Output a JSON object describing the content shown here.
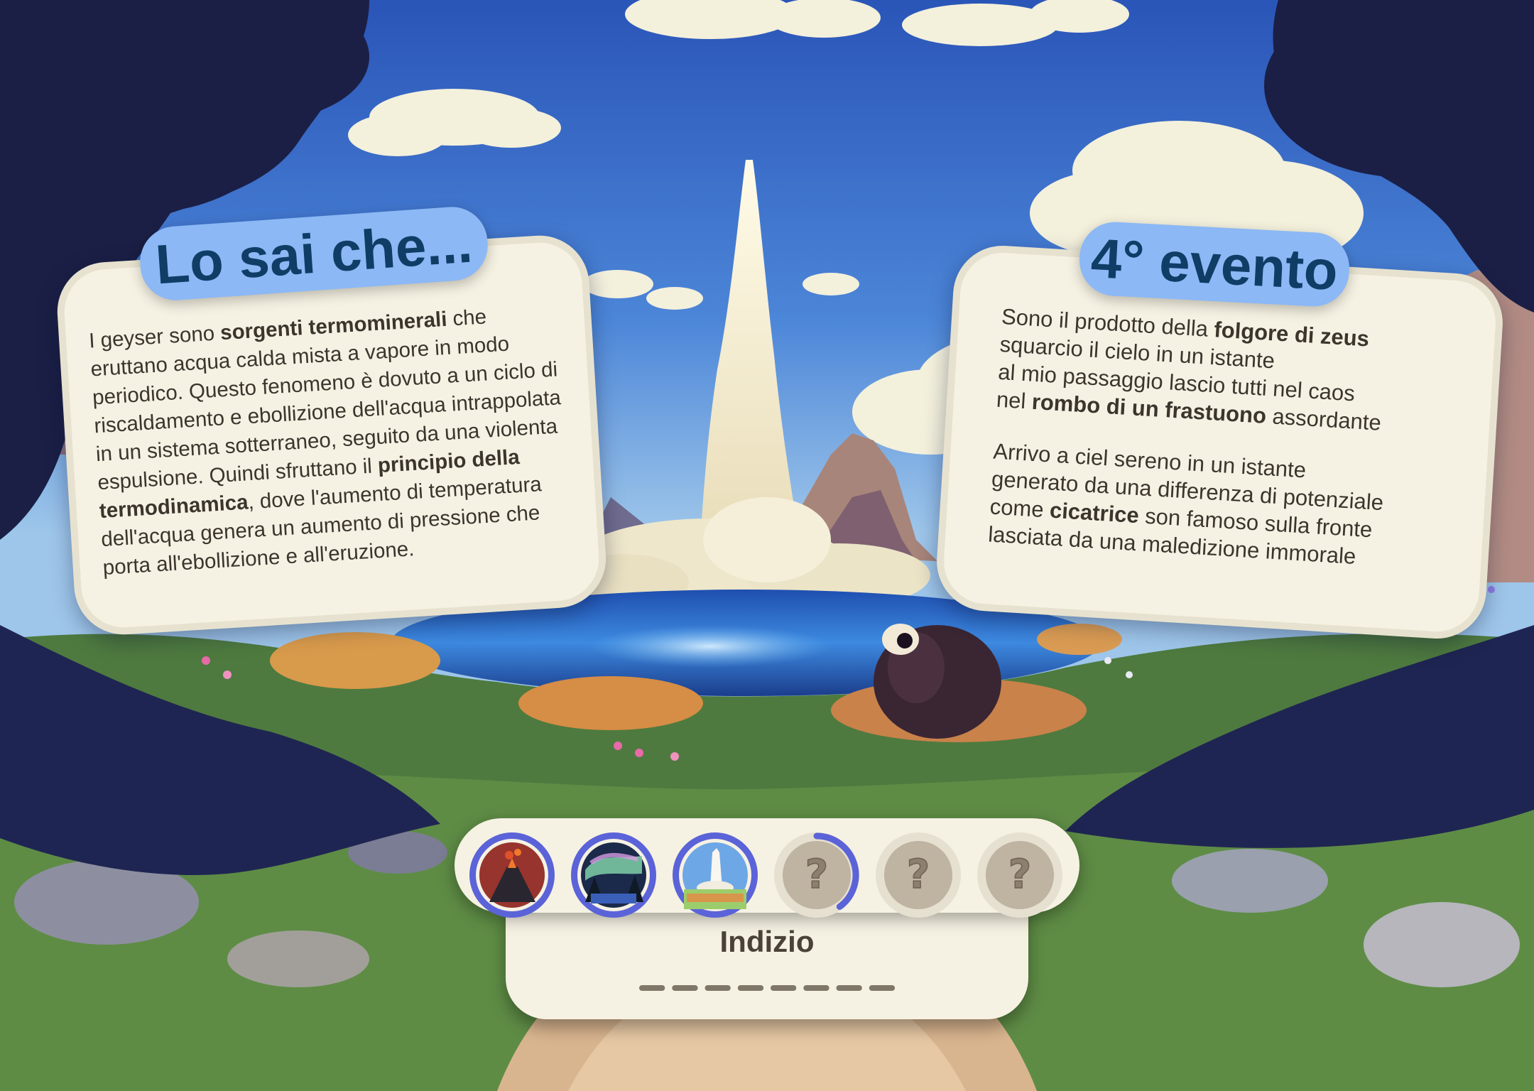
{
  "colors": {
    "card_bg": "#f6f2e3",
    "pill_bg": "#8cb8f5",
    "title_text": "#0f3d66",
    "progress_ring": "#5b63d8",
    "locked_slot": "#bfb3a2"
  },
  "fact_panel": {
    "title": "Lo sai che...",
    "segments": [
      {
        "text": "I geyser sono ",
        "bold": false
      },
      {
        "text": "sorgenti termominerali",
        "bold": true
      },
      {
        "text": " che eruttano acqua calda mista a vapore in modo periodico. Questo fenomeno è dovuto a un ciclo di riscaldamento e ebollizione dell'acqua intrappolata in un sistema sotterraneo, seguito da una violenta espulsione. Quindi sfruttano il ",
        "bold": false
      },
      {
        "text": "principio della termodinamica",
        "bold": true
      },
      {
        "text": ", dove l'aumento di temperatura dell'acqua genera un aumento di pressione che porta all'ebollizione e all'eruzione.",
        "bold": false
      }
    ]
  },
  "riddle_panel": {
    "title": "4° evento",
    "stanzas": [
      [
        [
          {
            "text": "Sono il prodotto della ",
            "bold": false
          },
          {
            "text": "folgore di zeus",
            "bold": true
          }
        ],
        [
          {
            "text": "squarcio il cielo in un istante",
            "bold": false
          }
        ],
        [
          {
            "text": "al mio passaggio lascio tutti nel caos",
            "bold": false
          }
        ],
        [
          {
            "text": "nel ",
            "bold": false
          },
          {
            "text": "rombo di un frastuono",
            "bold": true
          },
          {
            "text": " assordante",
            "bold": false
          }
        ]
      ],
      [
        [
          {
            "text": "Arrivo a ciel sereno in un istante",
            "bold": false
          }
        ],
        [
          {
            "text": "generato da una differenza di potenziale",
            "bold": false
          }
        ],
        [
          {
            "text": "come ",
            "bold": false
          },
          {
            "text": "cicatrice",
            "bold": true
          },
          {
            "text": " son famoso sulla fronte",
            "bold": false
          }
        ],
        [
          {
            "text": "lasciata da una maledizione immorale",
            "bold": false
          }
        ]
      ]
    ]
  },
  "progress": {
    "slots": [
      {
        "state": "completed",
        "icon": "volcano-icon"
      },
      {
        "state": "completed",
        "icon": "aurora-icon"
      },
      {
        "state": "completed",
        "icon": "geyser-icon"
      },
      {
        "state": "current",
        "icon": "question-mark-icon",
        "progress": 0.4,
        "symbol": "?"
      },
      {
        "state": "locked",
        "icon": "question-mark-icon",
        "symbol": "?"
      },
      {
        "state": "locked",
        "icon": "question-mark-icon",
        "symbol": "?"
      }
    ],
    "hint_label": "Indizio",
    "hint_letters": 8
  }
}
